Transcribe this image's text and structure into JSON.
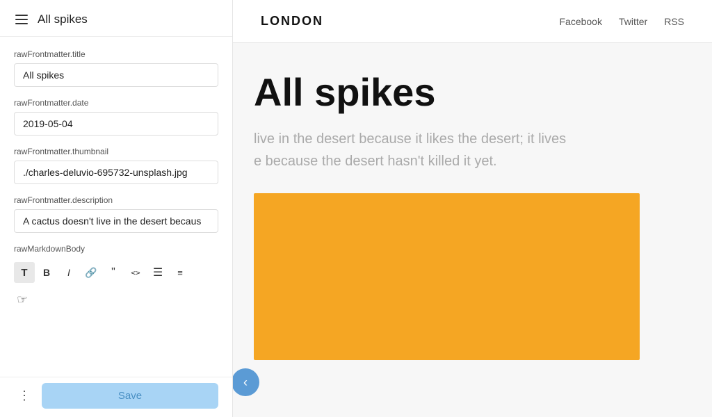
{
  "left": {
    "title": "All spikes",
    "fields": {
      "title_label": "rawFrontmatter.title",
      "title_value": "All spikes",
      "date_label": "rawFrontmatter.date",
      "date_value": "2019-05-04",
      "thumbnail_label": "rawFrontmatter.thumbnail",
      "thumbnail_value": "./charles-deluvio-695732-unsplash.jpg",
      "description_label": "rawFrontmatter.description",
      "description_value": "A cactus doesn't live in the desert becaus",
      "body_label": "rawMarkdownBody"
    },
    "toolbar": {
      "buttons": [
        "T",
        "B",
        "I",
        "🔗",
        "❝",
        "<>",
        "≡",
        "⊞"
      ]
    },
    "footer": {
      "save_label": "Save"
    }
  },
  "right": {
    "header": {
      "site_title": "LONDON",
      "nav": [
        {
          "label": "Facebook"
        },
        {
          "label": "Twitter"
        },
        {
          "label": "RSS"
        }
      ]
    },
    "article": {
      "title": "All spikes",
      "excerpt": "live in the desert because it likes the desert; it lives\ne because the desert hasn't killed it yet."
    }
  }
}
